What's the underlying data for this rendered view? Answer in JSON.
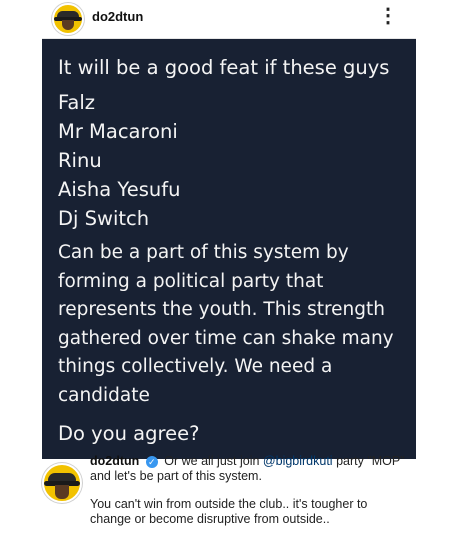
{
  "header": {
    "username": "do2dtun",
    "more_icon": "⋮"
  },
  "post": {
    "intro": "It will be a good feat if these guys",
    "names": [
      "Falz",
      "Mr Macaroni",
      "Rinu",
      "Aisha Yesufu",
      "Dj Switch"
    ],
    "body": "Can be a part of this system by forming a political party that represents the youth. This strength gathered over time can shake many things collectively. We need a candidate",
    "question": "Do you agree?"
  },
  "comment": {
    "username": "do2dtun",
    "verified_icon": "✓",
    "text_before": "Or we all just join ",
    "mention": "@bigbirdkuti",
    "text_after": " party \"MOP\" and let's be part of this system.",
    "second_text": "You can't win from outside the club.. it's tougher to change or become disruptive from outside.."
  },
  "colors": {
    "post_background": "#182133",
    "mention": "#00376b",
    "verified": "#3897f0"
  }
}
